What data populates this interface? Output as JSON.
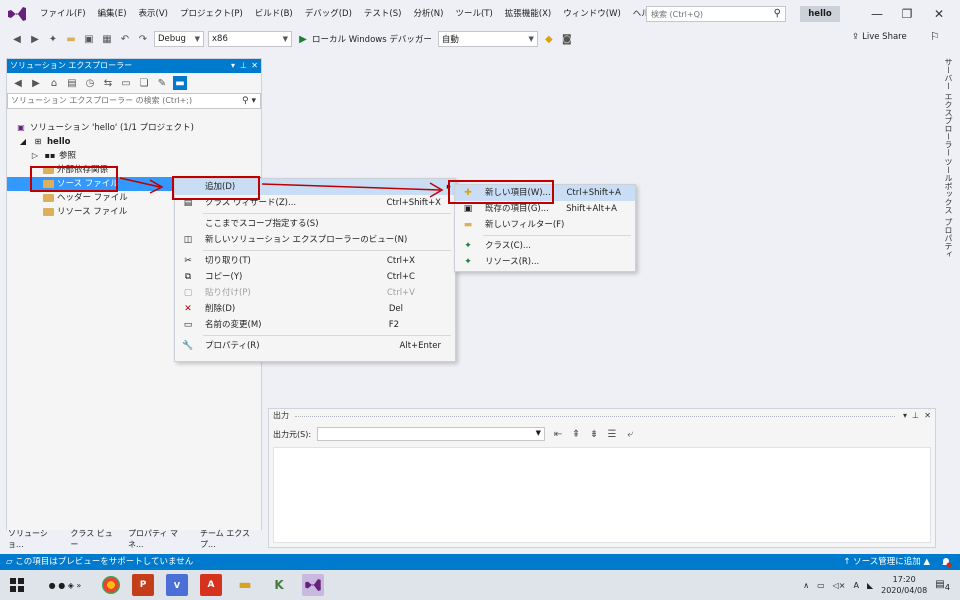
{
  "menu": [
    "ファイル(F)",
    "編集(E)",
    "表示(V)",
    "プロジェクト(P)",
    "ビルド(B)",
    "デバッグ(D)",
    "テスト(S)",
    "分析(N)",
    "ツール(T)",
    "拡張機能(X)",
    "ウィンドウ(W)",
    "ヘルプ(H)"
  ],
  "search": {
    "placeholder": "検索 (Ctrl+Q)"
  },
  "solution_name": "hello",
  "toolbar": {
    "config": "Debug",
    "platform": "x86",
    "debugger": "ローカル Windows デバッガー",
    "auto": "自動",
    "live_share": "Live Share"
  },
  "side_tabs": [
    "サーバー エクスプローラー",
    "ツールボックス",
    "プロパティ"
  ],
  "solution_explorer": {
    "title": "ソリューション エクスプローラー",
    "search_placeholder": "ソリューション エクスプローラー の検索 (Ctrl+;)",
    "tree": {
      "solution": "ソリューション 'hello' (1/1 プロジェクト)",
      "project": "hello",
      "references": "参照",
      "external_deps": "外部依存関係",
      "source_files": "ソース ファイル",
      "header_files": "ヘッダー ファイル",
      "resource_files": "リソース ファイル"
    },
    "bottom_tabs": [
      "ソリューショ...",
      "クラス ビュー",
      "プロパティ マネ...",
      "チーム エクスプ..."
    ]
  },
  "context_menu": {
    "items": [
      {
        "label": "追加(D)",
        "shortcut": ""
      },
      {
        "label": "クラス ウィザード(Z)...",
        "shortcut": "Ctrl+Shift+X"
      },
      {
        "label": "ここまでスコープ指定する(S)",
        "shortcut": ""
      },
      {
        "label": "新しいソリューション エクスプローラーのビュー(N)",
        "shortcut": ""
      },
      {
        "label": "切り取り(T)",
        "shortcut": "Ctrl+X"
      },
      {
        "label": "コピー(Y)",
        "shortcut": "Ctrl+C"
      },
      {
        "label": "貼り付け(P)",
        "shortcut": "Ctrl+V"
      },
      {
        "label": "削除(D)",
        "shortcut": "Del"
      },
      {
        "label": "名前の変更(M)",
        "shortcut": "F2"
      },
      {
        "label": "プロパティ(R)",
        "shortcut": "Alt+Enter"
      }
    ]
  },
  "submenu": {
    "items": [
      {
        "label": "新しい項目(W)...",
        "shortcut": "Ctrl+Shift+A"
      },
      {
        "label": "既存の項目(G)...",
        "shortcut": "Shift+Alt+A"
      },
      {
        "label": "新しいフィルター(F)",
        "shortcut": ""
      },
      {
        "label": "クラス(C)...",
        "shortcut": ""
      },
      {
        "label": "リソース(R)...",
        "shortcut": ""
      }
    ]
  },
  "output": {
    "title": "出力",
    "source_label": "出力元(S):"
  },
  "status": {
    "message": "この項目はプレビューをサポートしていません",
    "right": "↑ ソース管理に追加 ▲"
  },
  "clock": {
    "time": "17:20",
    "date": "2020/04/08"
  },
  "tray_badge": "4",
  "colors": {
    "accent": "#007acc",
    "highlight_red": "#c00000",
    "selection": "#3399ff"
  }
}
